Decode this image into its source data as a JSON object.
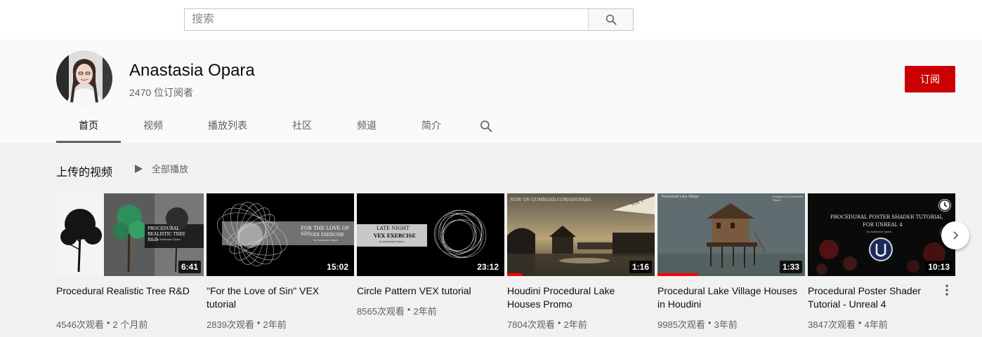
{
  "search": {
    "placeholder": "搜索",
    "value": ""
  },
  "channel": {
    "name": "Anastasia Opara",
    "subscribers": "2470 位订阅者",
    "subscribe_label": "订阅"
  },
  "tabs": [
    {
      "label": "首页",
      "active": true
    },
    {
      "label": "视频"
    },
    {
      "label": "播放列表"
    },
    {
      "label": "社区"
    },
    {
      "label": "频道"
    },
    {
      "label": "简介"
    }
  ],
  "shelf": {
    "title": "上传的视频",
    "play_all_label": "全部播放"
  },
  "videos": [
    {
      "title": "Procedural Realistic Tree R&D",
      "duration": "6:41",
      "views": "4546次观看",
      "age": "2 个月前",
      "thumb_text": [
        "PROCEDURAL",
        "REALISTIC TREE",
        "R&D",
        "by Anastasia Opara"
      ]
    },
    {
      "title": "\"For the Love of Sin\" VEX tutorial",
      "duration": "15:02",
      "views": "2839次观看",
      "age": "2年前",
      "thumb_text": [
        "FOR THE LOVE OF SIN",
        "VEX EXERCISE",
        "by Anastasia Opara"
      ]
    },
    {
      "title": "Circle Pattern VEX tutorial",
      "duration": "23:12",
      "views": "8565次观看",
      "age": "2年前",
      "thumb_text": [
        "LATE NIGHT",
        "VEX EXERCISE",
        "by Anastasia Opara"
      ]
    },
    {
      "title": "Houdini Procedural Lake Houses Promo",
      "duration": "1:16",
      "views": "7804次观看",
      "age": "2年前",
      "progress": 0.1,
      "thumb_text": [
        "NOW ON GUMROAD.COM/ANOPARA",
        "VOL 1"
      ]
    },
    {
      "title": "Procedural Lake Village Houses in Houdini",
      "duration": "1:33",
      "views": "9985次观看",
      "age": "3年前",
      "progress": 0.27,
      "thumb_text": [
        "Procedural Lake Village",
        "Example of a Generated Result"
      ]
    },
    {
      "title": "Procedural Poster Shader Tutorial - Unreal 4",
      "duration": "10:13",
      "views": "3847次观看",
      "age": "4年前",
      "thumb_text": [
        "PROCEDURAL POSTER SHADER TUTORIAL",
        "FOR UNREAL 4",
        "by Anastasia Opara"
      ]
    }
  ],
  "meta_separator": "•"
}
